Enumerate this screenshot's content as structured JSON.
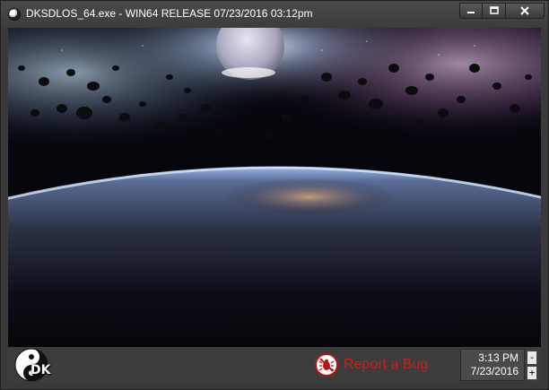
{
  "window": {
    "title": "DKSDLOS_64.exe - WIN64 RELEASE 07/23/2016 03:12pm"
  },
  "caption_buttons": {
    "minimize_icon": "minimize-icon",
    "maximize_icon": "maximize-icon",
    "close_icon": "close-icon"
  },
  "viewport": {
    "scene": "space-planet-asteroids-wallpaper"
  },
  "statusbar": {
    "logo_text": "DK",
    "report_bug_label": "Report a Bug",
    "report_bug_color": "#c62020",
    "clock_time": "3:13 PM",
    "clock_date": "7/23/2016",
    "spin_minus": "-",
    "spin_plus": "+"
  }
}
